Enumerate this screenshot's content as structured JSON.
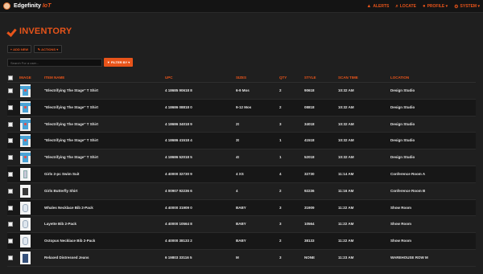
{
  "app": {
    "name": "Edgefinity",
    "sub": "IoT"
  },
  "nav": [
    {
      "icon": "warning-icon",
      "glyph": "▲",
      "label": "ALERTS"
    },
    {
      "icon": "search-icon",
      "glyph": "⌕",
      "label": "LOCATE"
    },
    {
      "icon": "user-icon",
      "glyph": "●",
      "label": "PROFILE ▾"
    },
    {
      "icon": "gear-icon",
      "glyph": "⚙",
      "label": "SYSTEM ▾"
    }
  ],
  "page": {
    "title": "INVENTORY"
  },
  "toolbar": {
    "add_label": "+ ADD NEW",
    "actions_label": "✎ ACTIONS ▾",
    "search_placeholder": "Search For a user...",
    "filter_label": "▼ FILTER BY ▾"
  },
  "columns": [
    "IMAGE",
    "ITEM NAME",
    "UPC",
    "SIZES",
    "QTY",
    "STYLE",
    "SCAN TIME",
    "LOCATION"
  ],
  "rows": [
    {
      "img": "tee",
      "name": "\"Electrifying The Stage\" T Shirt",
      "upc": "4 18685 90618 8",
      "size": "6-9 Mos",
      "qty": "2",
      "style": "90618",
      "time": "10:32 AM",
      "loc": "Design Studio"
    },
    {
      "img": "tee",
      "name": "\"Electrifying The Stage\" T Shirt",
      "upc": "4 18686 08818 0",
      "size": "9-12 Mos",
      "qty": "2",
      "style": "08818",
      "time": "10:32 AM",
      "loc": "Design Studio"
    },
    {
      "img": "tee",
      "name": "\"Electrifying The Stage\" T Shirt",
      "upc": "4 18686 34018 9",
      "size": "2t",
      "qty": "3",
      "style": "34018",
      "time": "10:32 AM",
      "loc": "Design Studio"
    },
    {
      "img": "tee",
      "name": "\"Electrifying The Stage\" T Shirt",
      "upc": "4 18686 41518 4",
      "size": "3t",
      "qty": "1",
      "style": "41518",
      "time": "10:32 AM",
      "loc": "Design Studio"
    },
    {
      "img": "tee",
      "name": "\"Electrifying The Stage\" T Shirt",
      "upc": "4 18686 52018 5",
      "size": "4t",
      "qty": "1",
      "style": "52018",
      "time": "10:32 AM",
      "loc": "Design Studio"
    },
    {
      "img": "swim",
      "name": "Girls 2-pc Swim Suit",
      "upc": "4 40000 32730 9",
      "size": "4 XS",
      "qty": "4",
      "style": "32730",
      "time": "11:14 AM",
      "loc": "Conference Room A"
    },
    {
      "img": "shirt",
      "name": "Girls Butterfly Shirt",
      "upc": "4 00907 92236 6",
      "size": "4",
      "qty": "2",
      "style": "92236",
      "time": "11:16 AM",
      "loc": "Conference Room B"
    },
    {
      "img": "bib",
      "name": "Whales Necklace Bib 2-Pack",
      "upc": "4 40000 31909 0",
      "size": "BABY",
      "qty": "3",
      "style": "31909",
      "time": "11:22 AM",
      "loc": "Show Room"
    },
    {
      "img": "bib",
      "name": "Layette Bib 2-Pack",
      "upc": "4 40000 10564 8",
      "size": "BABY",
      "qty": "3",
      "style": "10564",
      "time": "11:22 AM",
      "loc": "Show Room"
    },
    {
      "img": "bib",
      "name": "Octopus Necklace Bib 2-Pack",
      "upc": "4 40000 38133 2",
      "size": "BABY",
      "qty": "2",
      "style": "38133",
      "time": "11:22 AM",
      "loc": "Show Room"
    },
    {
      "img": "jeans",
      "name": "Relaxed Distressed Jeans",
      "upc": "6 19803 33116 5",
      "size": "M",
      "qty": "3",
      "style": "NONE",
      "time": "11:23 AM",
      "loc": "WAREHOUSE ROW M"
    }
  ]
}
